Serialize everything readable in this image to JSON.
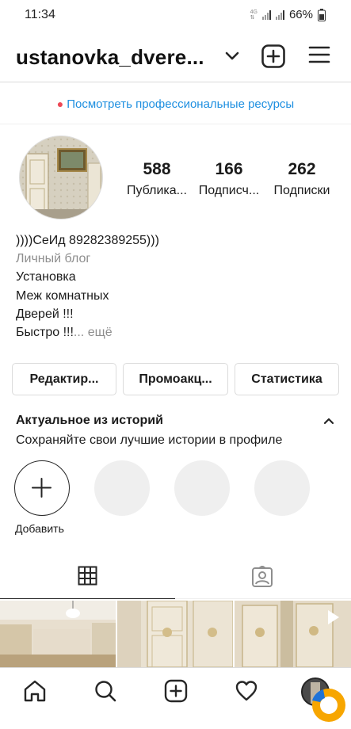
{
  "status_bar": {
    "time": "11:34",
    "network": "4G",
    "network_sub": "⇅",
    "battery": "66%"
  },
  "header": {
    "username": "ustanovka_dvere...",
    "icons": [
      "chevron-down-icon",
      "new-post-icon",
      "hamburger-menu-icon"
    ]
  },
  "pro_banner": {
    "text": "Посмотреть профессиональные ресурсы",
    "dot_color": "#ed4956",
    "link_color": "#1e8fe0"
  },
  "stats": [
    {
      "value": "588",
      "label": "Публика..."
    },
    {
      "value": "166",
      "label": "Подписч..."
    },
    {
      "value": "262",
      "label": "Подписки"
    }
  ],
  "bio": {
    "name": "))))СеИд 89282389255)))",
    "category": "Личный блог",
    "lines": [
      "Установка",
      "Меж комнатных",
      "Дверей !!!"
    ],
    "last_line": "Быстро !!!",
    "more": "... ещё"
  },
  "buttons": {
    "edit": "Редактир...",
    "promo": "Промоакц...",
    "stats": "Статистика"
  },
  "highlights": {
    "title": "Актуальное из историй",
    "subtitle": "Сохраняйте свои лучшие истории в профиле",
    "add_label": "Добавить"
  },
  "tabs": [
    "grid-icon",
    "tagged-icon"
  ],
  "bottom_nav": [
    "home-icon",
    "search-icon",
    "add-post-icon",
    "heart-icon",
    "profile-avatar"
  ]
}
